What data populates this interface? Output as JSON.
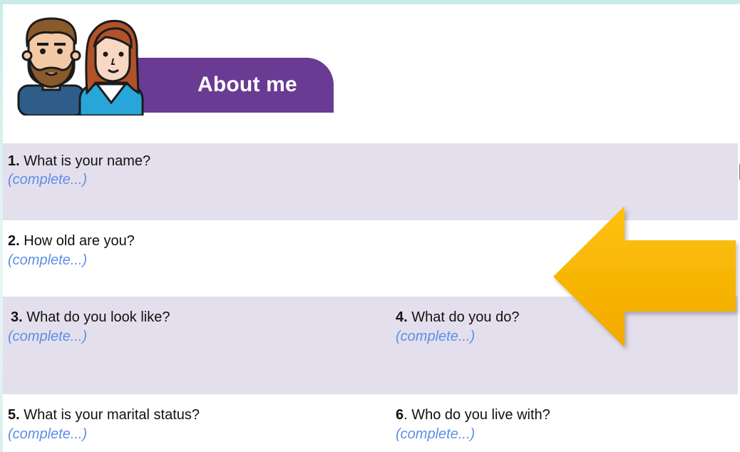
{
  "header": {
    "title": "About me"
  },
  "placeholder": "(complete...)",
  "questions": [
    {
      "num": "1.",
      "text": " What is your name?",
      "answer": "(complete...)"
    },
    {
      "num": "2.",
      "text": " How old are you?",
      "answer": "(complete...)"
    },
    {
      "num": "3.",
      "text": " What do you look like?",
      "answer": "(complete...)"
    },
    {
      "num": "4.",
      "text": " What do you do?",
      "answer": "(complete...)"
    },
    {
      "num": "5.",
      "text": " What is your marital status?",
      "answer": "(complete...)"
    },
    {
      "num": "6",
      "text": ". Who do you live with?",
      "answer": "(complete...)"
    }
  ],
  "colors": {
    "banner": "#6a3b93",
    "row_shade": "#e4dfec",
    "answer_text": "#5b8fe6",
    "arrow": "#f7b500"
  }
}
